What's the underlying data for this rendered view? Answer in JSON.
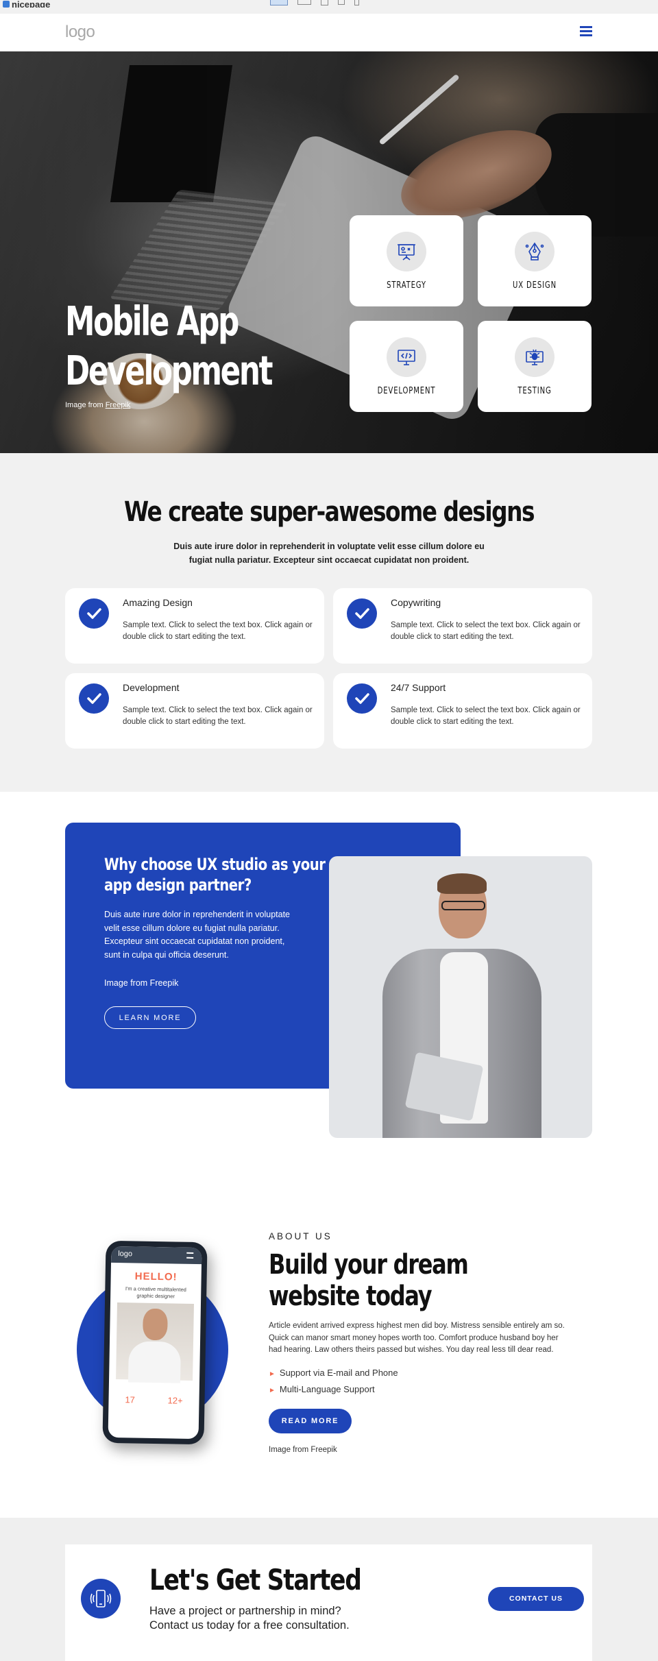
{
  "editor": {
    "brand": "nicepage",
    "devices": [
      "desktop",
      "laptop",
      "tablet",
      "phone-landscape",
      "phone"
    ]
  },
  "header": {
    "logo": "logo",
    "menu_icon": "hamburger-menu-icon"
  },
  "hero": {
    "title_line1": "Mobile App",
    "title_line2": "Development",
    "credit_prefix": "Image from ",
    "credit_link": "Freepik",
    "cards": [
      {
        "label": "STRATEGY",
        "icon": "strategy-board-icon"
      },
      {
        "label": "UX DESIGN",
        "icon": "pen-tool-icon"
      },
      {
        "label": "DEVELOPMENT",
        "icon": "code-monitor-icon"
      },
      {
        "label": "TESTING",
        "icon": "bug-monitor-icon"
      }
    ]
  },
  "features": {
    "title": "We create super-awesome designs",
    "subtitle": "Duis aute irure dolor in reprehenderit in voluptate velit esse cillum dolore eu fugiat nulla pariatur. Excepteur sint occaecat cupidatat non proident.",
    "items": [
      {
        "title": "Amazing Design",
        "text": "Sample text. Click to select the text box. Click again or double click to start editing the text."
      },
      {
        "title": "Copywriting",
        "text": "Sample text. Click to select the text box. Click again or double click to start editing the text."
      },
      {
        "title": "Development",
        "text": "Sample text. Click to select the text box. Click again or double click to start editing the text."
      },
      {
        "title": "24/7 Support",
        "text": "Sample text. Click to select the text box. Click again or double click to start editing the text."
      }
    ]
  },
  "why": {
    "title_line1": "Why choose UX studio as your",
    "title_line2": "app design partner?",
    "text": "Duis aute irure dolor in reprehenderit in voluptate velit esse cillum dolore eu fugiat nulla pariatur. Excepteur sint occaecat cupidatat non proident, sunt in culpa qui officia deserunt.",
    "credit": "Image from Freepik",
    "button": "LEARN MORE"
  },
  "about": {
    "kicker": "ABOUT US",
    "title_line1": "Build your dream",
    "title_line2": "website today",
    "text": "Article evident arrived express highest men did boy. Mistress sensible entirely am so. Quick can manor smart money hopes worth too. Comfort produce husband boy her had hearing. Law others theirs passed but wishes. You day real less till dear read.",
    "list": [
      "Support via E-mail and Phone",
      "Multi-Language Support"
    ],
    "button": "READ MORE",
    "credit": "Image from Freepik",
    "phone": {
      "logo": "logo",
      "hello": "HELLO!",
      "subtitle": "I'm a creative multitalented graphic designer",
      "stat1": "17",
      "stat2": "12+"
    }
  },
  "cta": {
    "title": "Let's Get Started",
    "text_line1": "Have a project or partnership in mind?",
    "text_line2": "Contact us today for a free consultation.",
    "button": "CONTACT US",
    "icon": "phone-vibrate-icon"
  },
  "colors": {
    "accent": "#1f45b8",
    "orange": "#f26b4f",
    "section_gray": "#f1f1f1"
  }
}
